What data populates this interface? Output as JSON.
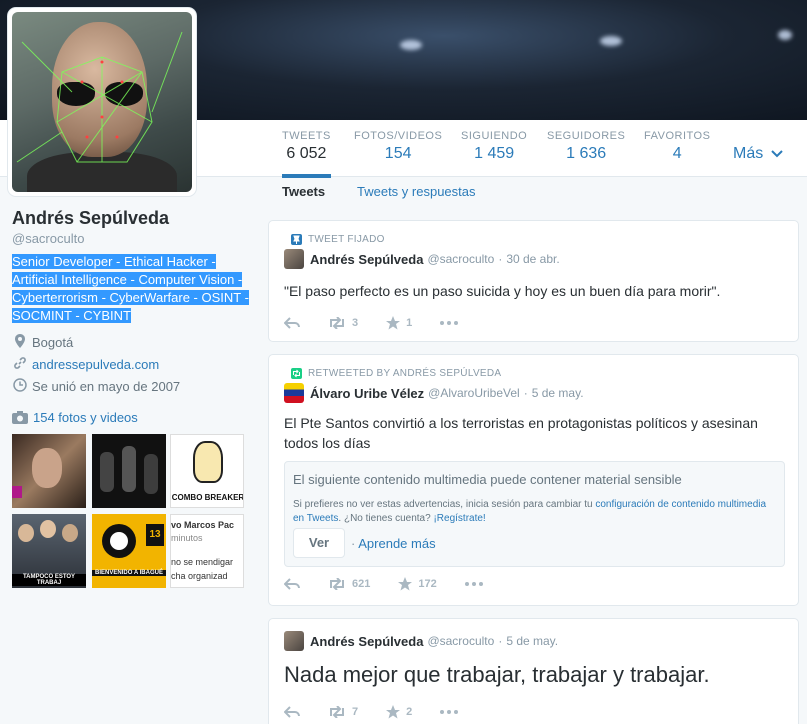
{
  "profile": {
    "name": "Andrés Sepúlveda",
    "handle": "@sacroculto",
    "bio_lines": [
      "Senior Developer - Ethical Hacker -",
      "Artificial Intelligence - Computer Vision -",
      "Cyberterrorism - CyberWarfare - OSINT -",
      "SOCMINT - CYBINT"
    ],
    "location": "Bogotá",
    "website": "andressepulveda.com",
    "joined": "Se unió en mayo de 2007",
    "photos_link": "154 fotos y videos"
  },
  "stats": [
    {
      "label": "TWEETS",
      "value": "6 052"
    },
    {
      "label": "FOTOS/VIDEOS",
      "value": "154"
    },
    {
      "label": "SIGUIENDO",
      "value": "1 459"
    },
    {
      "label": "SEGUIDORES",
      "value": "1 636"
    },
    {
      "label": "FAVORITOS",
      "value": "4"
    }
  ],
  "more_label": "Más",
  "tabs": {
    "tweets": "Tweets",
    "replies": "Tweets y respuestas"
  },
  "thumbs": {
    "t3_caption": "COMBO BREAKER",
    "t4_caption": "TAMPOCO ESTOY TRABAJ",
    "t5_number": "13",
    "t5_caption": "BIENVENIDO A IBAGUÉ",
    "t6_line1": "vo Marcos Pac",
    "t6_line2": "minutos",
    "t6_line3": "no se mendigar",
    "t6_line4": "cha organizad"
  },
  "tweets": [
    {
      "context": "TWEET FIJADO",
      "author": "Andrés Sepúlveda",
      "handle": "@sacroculto",
      "date": "30 de abr.",
      "text": "\"El paso perfecto es un paso suicida y hoy es un buen día para morir\".",
      "retweets": "3",
      "favorites": "1"
    },
    {
      "context": "RETWEETED BY ANDRÉS SEPÚLVEDA",
      "author": "Álvaro Uribe Vélez",
      "handle": "@AlvaroUribeVel",
      "date": "5 de may.",
      "text": "El Pte Santos convirtió a los terroristas en protagonistas políticos y asesinan todos los días",
      "sensitive_title": "El siguiente contenido multimedia puede contener material sensible",
      "sensitive_text_a": "Si prefieres no ver estas advertencias, inicia sesión para cambiar tu ",
      "sensitive_link": "configuración de contenido multimedia en Tweets",
      "sensitive_text_b": ". ¿No tienes cuenta? ",
      "sensitive_signup": "¡Regístrate!",
      "view_button": "Ver",
      "learn_more": "Aprende más",
      "retweets": "621",
      "favorites": "172"
    },
    {
      "author": "Andrés Sepúlveda",
      "handle": "@sacroculto",
      "date": "5 de may.",
      "text": "Nada mejor que trabajar, trabajar y trabajar.",
      "retweets": "7",
      "favorites": "2"
    }
  ],
  "separator": "·",
  "icons": [
    "location-icon",
    "link-icon",
    "calendar-icon",
    "camera-icon",
    "pin-icon",
    "retweet-icon",
    "reply-icon",
    "star-icon",
    "more-icon",
    "chevron-down-icon"
  ],
  "colors": {
    "link": "#2b7bb9",
    "muted": "#8899a6",
    "selection": "#3399ff",
    "retweet_green": "#19cf86"
  }
}
